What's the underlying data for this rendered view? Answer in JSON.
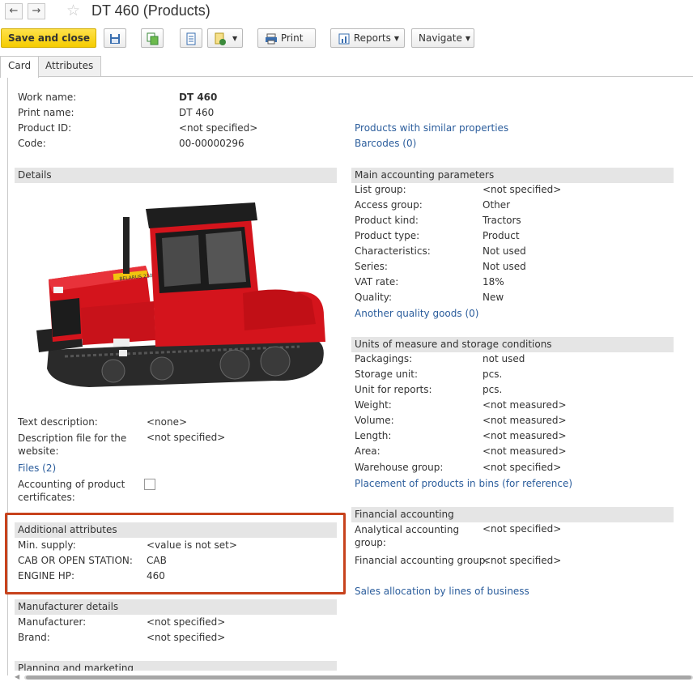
{
  "window": {
    "title": "DT 460 (Products)",
    "back_icon": "←",
    "forward_icon": "→",
    "star_icon": "☆"
  },
  "toolbar": {
    "save_close": "Save and close",
    "print": "Print",
    "reports": "Reports",
    "navigate": "Navigate"
  },
  "tabs": [
    {
      "label": "Card"
    },
    {
      "label": "Attributes"
    }
  ],
  "header_info": {
    "work_name_label": "Work name:",
    "work_name_value": "DT 460",
    "print_name_label": "Print name:",
    "print_name_value": "DT 460",
    "product_id_label": "Product ID:",
    "product_id_value": "<not specified>",
    "code_label": "Code:",
    "code_value": "00-00000296",
    "similar_link": "Products with similar properties",
    "barcodes_link": "Barcodes (0)"
  },
  "details": {
    "header": "Details",
    "text_desc_label": "Text description:",
    "text_desc_value": "<none>",
    "desc_file_label": "Description file for the website:",
    "desc_file_value": "<not specified>",
    "files_link": "Files (2)",
    "certificates_label": "Accounting of product certificates:",
    "tractor_brand_text": "BELARUS 2103"
  },
  "additional": {
    "header": "Additional attributes",
    "rows": [
      {
        "label": "Min. supply:",
        "value": "<value is not set>"
      },
      {
        "label": "CAB OR OPEN STATION:",
        "value": "CAB"
      },
      {
        "label": "ENGINE HP:",
        "value": "460"
      }
    ]
  },
  "manufacturer": {
    "header": "Manufacturer details",
    "rows": [
      {
        "label": "Manufacturer:",
        "value": "<not specified>"
      },
      {
        "label": "Brand:",
        "value": "<not specified>"
      }
    ]
  },
  "planning": {
    "header": "Planning and marketing"
  },
  "main_params": {
    "header": "Main accounting parameters",
    "rows": [
      {
        "label": "List group:",
        "value": "<not specified>"
      },
      {
        "label": "Access group:",
        "value": "Other"
      },
      {
        "label": "Product kind:",
        "value": "Tractors"
      },
      {
        "label": "Product type:",
        "value": "Product"
      },
      {
        "label": "Characteristics:",
        "value": "Not used"
      },
      {
        "label": "Series:",
        "value": "Not used"
      },
      {
        "label": "VAT rate:",
        "value": "18%"
      },
      {
        "label": "Quality:",
        "value": "New"
      }
    ],
    "quality_link": "Another quality goods (0)"
  },
  "units": {
    "header": "Units of measure and storage conditions",
    "rows": [
      {
        "label": "Packagings:",
        "value": "not used"
      },
      {
        "label": "Storage unit:",
        "value": "pcs."
      },
      {
        "label": "Unit for reports:",
        "value": "pcs."
      },
      {
        "label": "Weight:",
        "value": "<not measured>"
      },
      {
        "label": "Volume:",
        "value": "<not measured>"
      },
      {
        "label": "Length:",
        "value": "<not measured>"
      },
      {
        "label": "Area:",
        "value": "<not measured>"
      },
      {
        "label": "Warehouse group:",
        "value": "<not specified>"
      }
    ],
    "placement_link": "Placement of products in bins (for reference)"
  },
  "financial": {
    "header": "Financial accounting",
    "analytical_label": "Analytical accounting group:",
    "analytical_value": "<not specified>",
    "fin_group_label": "Financial accounting group:",
    "fin_group_value": "<not specified>",
    "sales_link": "Sales allocation by lines of business"
  },
  "colors": {
    "accent_yellow": "#f5cc00",
    "link_blue": "#2b5d9c",
    "highlight_red": "#c7421c",
    "tractor_red": "#d4141c"
  }
}
